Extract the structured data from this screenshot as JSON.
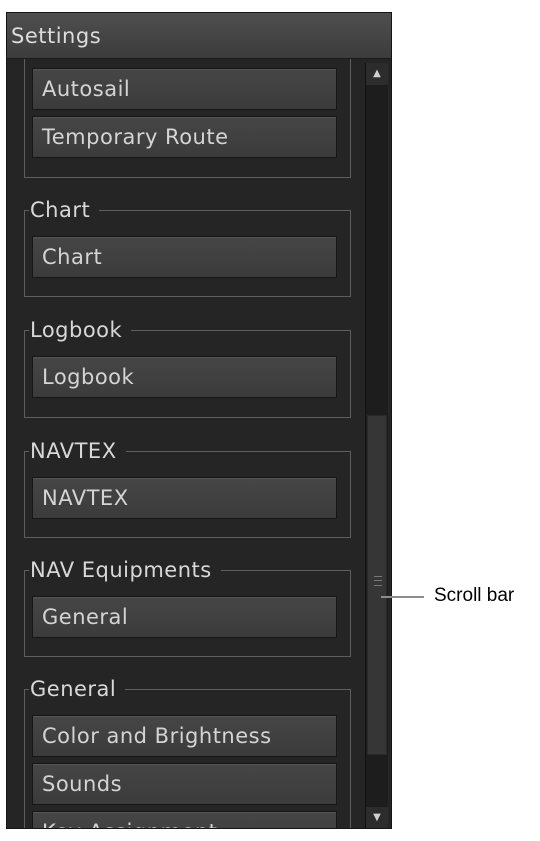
{
  "window": {
    "title": "Settings"
  },
  "groups": [
    {
      "legend": "",
      "buttons": [
        "Autosail",
        "Temporary Route"
      ]
    },
    {
      "legend": "Chart",
      "buttons": [
        "Chart"
      ]
    },
    {
      "legend": "Logbook",
      "buttons": [
        "Logbook"
      ]
    },
    {
      "legend": "NAVTEX",
      "buttons": [
        "NAVTEX"
      ]
    },
    {
      "legend": "NAV Equipments",
      "buttons": [
        "General"
      ]
    },
    {
      "legend": "General",
      "buttons": [
        "Color and Brightness",
        "Sounds",
        "Key Assignment"
      ]
    }
  ],
  "scrollbar": {
    "up_icon": "▲",
    "down_icon": "▼"
  },
  "annotation": {
    "label": "Scroll bar"
  }
}
